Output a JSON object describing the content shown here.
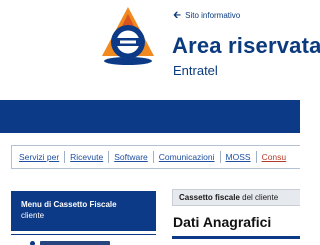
{
  "header": {
    "back_link": "Sito informativo",
    "title": "Area riservata",
    "subtitle": "Entratel",
    "logo_icon": "agenzia-entrate-logo-icon",
    "back_icon": "arrow-left-icon"
  },
  "service_menu": {
    "items": [
      "Servizi per",
      "Ricevute",
      "Software",
      "Comunicazioni",
      "MOSS",
      "Consu"
    ]
  },
  "side_menu": {
    "heading_line1": "Menu di Cassetto Fiscale",
    "heading_line2": "cliente"
  },
  "main": {
    "breadcrumb_bold": "Cassetto fiscale",
    "breadcrumb_rest": " del cliente",
    "page_title": "Dati Anagrafici"
  },
  "colors": {
    "brand_blue": "#0d3a86",
    "link_blue": "#1f4fa0",
    "logo_orange": "#f08a1e",
    "active_red": "#b33a2b"
  }
}
